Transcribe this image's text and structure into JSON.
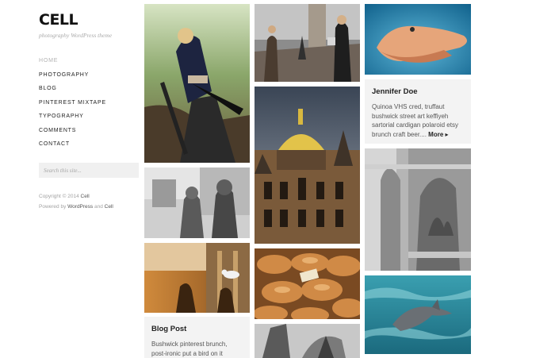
{
  "site": {
    "title": "CELL",
    "tagline": "photography WordPress theme"
  },
  "nav": {
    "items": [
      {
        "label": "HOME",
        "active": true
      },
      {
        "label": "PHOTOGRAPHY"
      },
      {
        "label": "BLOG"
      },
      {
        "label": "PINTEREST MIXTAPE"
      },
      {
        "label": "TYPOGRAPHY"
      },
      {
        "label": "COMMENTS"
      },
      {
        "label": "CONTACT"
      }
    ]
  },
  "search": {
    "placeholder": "Search this site..."
  },
  "footer": {
    "copyright": "Copyright © 2014",
    "copyright_link": "Cell",
    "powered_prefix": "Powered by",
    "powered_link": "WordPress",
    "powered_and": "and",
    "powered_theme": "Cell"
  },
  "posts": {
    "jennifer": {
      "title": "Jennifer Doe",
      "excerpt": "Quinoa VHS cred, truffaut bushwick street art keffiyeh sartorial cardigan polaroid etsy brunch craft beer....",
      "more": "More ▸"
    },
    "blog": {
      "title": "Blog Post",
      "excerpt": "Bushwick pinterest brunch, post-ironic put a bird on it"
    }
  },
  "colors": {
    "card_bg": "#f3f3f3",
    "nav_active": "#b3b3b3",
    "text_dark": "#222222"
  }
}
